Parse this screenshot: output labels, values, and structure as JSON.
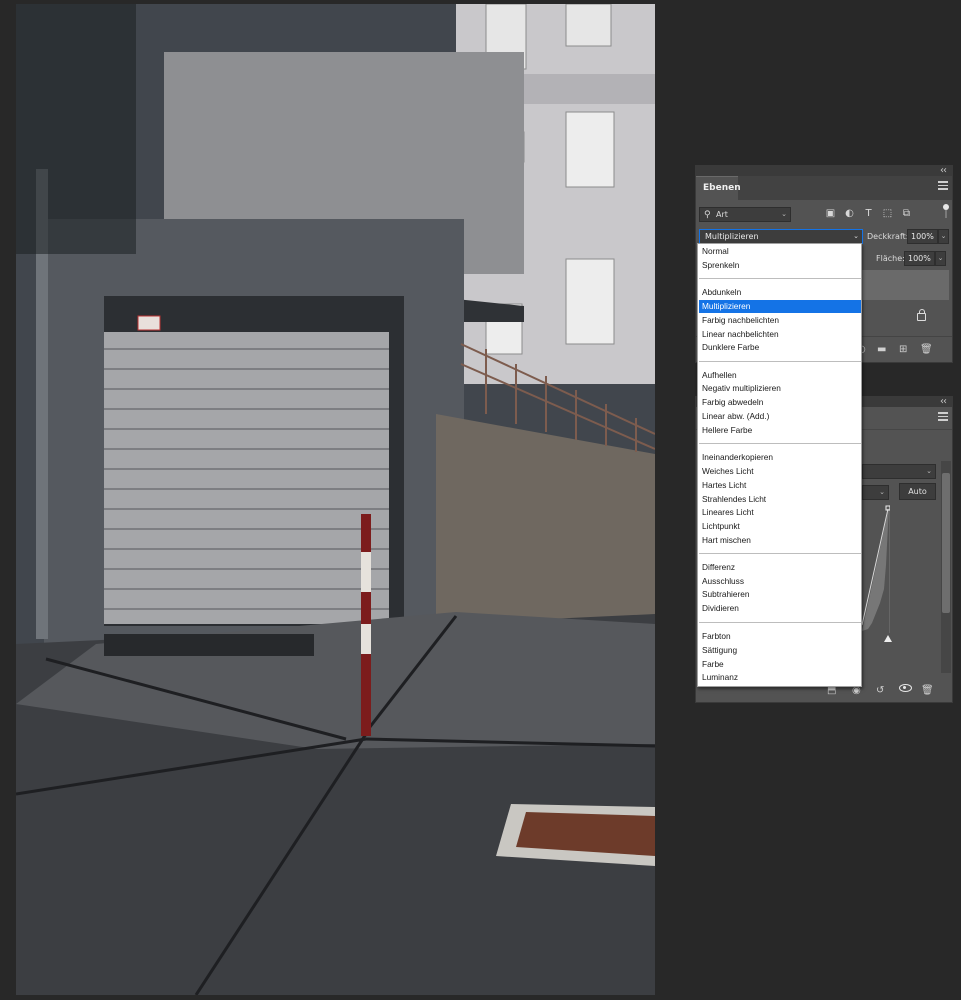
{
  "layers_panel": {
    "tab_label": "Ebenen",
    "filter_label": "Art",
    "blend_mode": "Multiplizieren",
    "opacity_label": "Deckkraft:",
    "opacity_value": "100%",
    "fill_label": "Fläche:",
    "fill_value": "100%",
    "filter_icons": [
      "image-icon",
      "adjustment-icon",
      "type-icon",
      "shape-icon",
      "smart-object-icon"
    ]
  },
  "adjustments_panel": {
    "auto_label": "Auto"
  },
  "blend_menu": {
    "selected": "Multiplizieren",
    "groups": [
      [
        "Normal",
        "Sprenkeln"
      ],
      [
        "Abdunkeln",
        "Multiplizieren",
        "Farbig nachbelichten",
        "Linear nachbelichten",
        "Dunklere Farbe"
      ],
      [
        "Aufhellen",
        "Negativ multiplizieren",
        "Farbig abwedeln",
        "Linear abw. (Add.)",
        "Hellere Farbe"
      ],
      [
        "Ineinanderkopieren",
        "Weiches Licht",
        "Hartes Licht",
        "Strahlendes Licht",
        "Lineares Licht",
        "Lichtpunkt",
        "Hart mischen"
      ],
      [
        "Differenz",
        "Ausschluss",
        "Subtrahieren",
        "Dividieren"
      ],
      [
        "Farbton",
        "Sättigung",
        "Farbe",
        "Luminanz"
      ]
    ]
  },
  "colors": {
    "accent": "#1473e6",
    "panel_bg": "#535353",
    "workspace_bg": "#282828"
  }
}
